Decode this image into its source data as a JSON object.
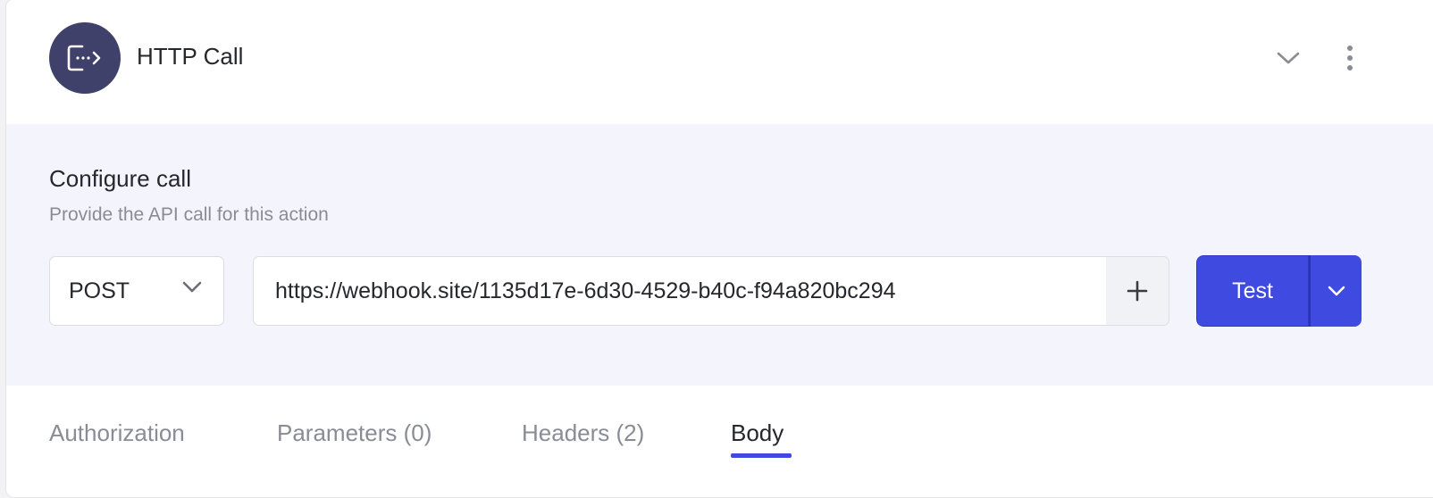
{
  "header": {
    "title": "HTTP Call",
    "icon": "http-call-icon",
    "collapse_icon": "chevron-down-icon",
    "menu_icon": "more-vertical-icon"
  },
  "config": {
    "title": "Configure call",
    "subtitle": "Provide the API call for this action",
    "method": "POST",
    "url": "https://webhook.site/1135d17e-6d30-4529-b40c-f94a820bc294",
    "add_icon": "plus-icon",
    "test_label": "Test"
  },
  "tabs": [
    {
      "label": "Authorization",
      "active": false
    },
    {
      "label": "Parameters (0)",
      "active": false
    },
    {
      "label": "Headers (2)",
      "active": false
    },
    {
      "label": "Body",
      "active": true
    }
  ],
  "colors": {
    "accent": "#3f4ae0",
    "icon_bg": "#40416b",
    "config_bg": "#f4f5fc"
  }
}
